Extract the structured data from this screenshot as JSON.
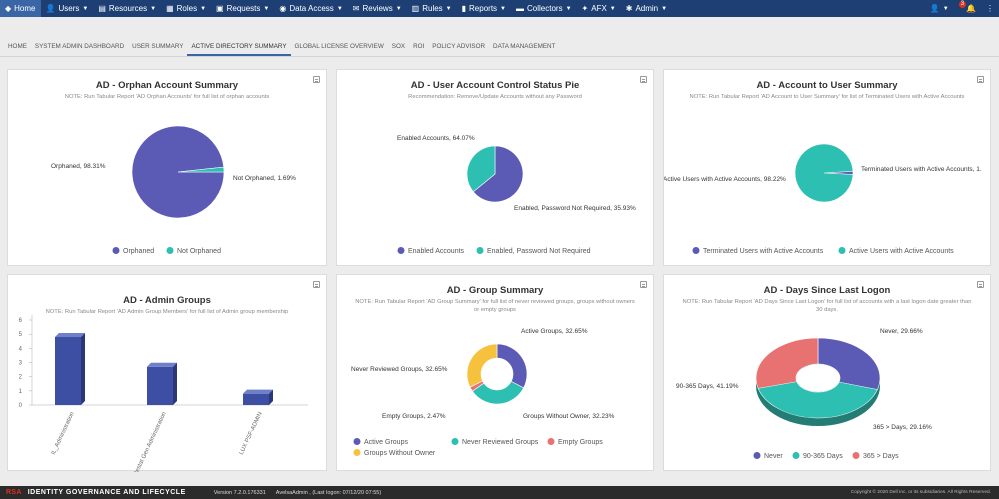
{
  "nav": {
    "items": [
      {
        "label": "Home",
        "icon": "logo-icon",
        "glyph": "◆",
        "caret": false,
        "active": true
      },
      {
        "label": "Users",
        "icon": "users-icon",
        "glyph": "👤",
        "caret": true
      },
      {
        "label": "Resources",
        "icon": "resources-icon",
        "glyph": "▤",
        "caret": true
      },
      {
        "label": "Roles",
        "icon": "roles-icon",
        "glyph": "▦",
        "caret": true
      },
      {
        "label": "Requests",
        "icon": "requests-icon",
        "glyph": "▣",
        "caret": true
      },
      {
        "label": "Data Access",
        "icon": "data-access-icon",
        "glyph": "◉",
        "caret": true
      },
      {
        "label": "Reviews",
        "icon": "reviews-icon",
        "glyph": "✉",
        "caret": true
      },
      {
        "label": "Rules",
        "icon": "rules-icon",
        "glyph": "▥",
        "caret": true
      },
      {
        "label": "Reports",
        "icon": "reports-icon",
        "glyph": "▮",
        "caret": true
      },
      {
        "label": "Collectors",
        "icon": "collectors-icon",
        "glyph": "▬",
        "caret": true
      },
      {
        "label": "AFX",
        "icon": "afx-icon",
        "glyph": "✦",
        "caret": true
      },
      {
        "label": "Admin",
        "icon": "admin-icon",
        "glyph": "✱",
        "caret": true
      }
    ],
    "notif_count": "3"
  },
  "tabs": [
    "Home",
    "System Admin Dashboard",
    "User Summary",
    "Active Directory Summary",
    "Global License Overview",
    "SOX",
    "ROI",
    "Policy Advisor",
    "Data Management"
  ],
  "panels": {
    "orphan": {
      "title": "AD - Orphan Account Summary",
      "note": "NOTE: Run Tabular Report 'AD Orphan Accounts' for full list of orphan accounts",
      "labels": [
        "Orphaned, 98.31%",
        "Not Orphaned, 1.69%"
      ],
      "legend": [
        "Orphaned",
        "Not Orphaned"
      ]
    },
    "uac": {
      "title": "AD - User Account Control Status Pie",
      "note": "Recommendation: Remove/Update Accounts without any Password",
      "labels": [
        "Enabled Accounts, 64.07%",
        "Enabled, Password Not Required, 35.93%"
      ],
      "legend": [
        "Enabled Accounts",
        "Enabled, Password Not Required"
      ]
    },
    "acct": {
      "title": "AD - Account to User Summary",
      "note": "NOTE: Run Tabular Report 'AD Account to User Summary' for list of Terminated Users with Active Accounts",
      "labels": [
        "Active Users with Active Accounts, 98.22%",
        "Terminated Users with Active Accounts, 1."
      ],
      "legend": [
        "Terminated Users with Active Accounts",
        "Active Users with Active Accounts"
      ]
    },
    "admin": {
      "title": "AD - Admin Groups",
      "note": "NOTE: Run Tabular Report 'AD Admin Group Members' for full list of Admin group membership"
    },
    "group": {
      "title": "AD - Group Summary",
      "note": "NOTE: Run Tabular Report 'AD Group Summary' for full list of never reviewed groups, groups without owners or empty groups",
      "labels": [
        "Active Groups, 32.65%",
        "Never Reviewed Groups, 32.65%",
        "Empty Groups, 2.47%",
        "Groups Without Owner, 32.23%"
      ],
      "legend": [
        "Active Groups",
        "Never Reviewed Groups",
        "Empty Groups",
        "Groups Without Owner"
      ]
    },
    "logon": {
      "title": "AD - Days Since Last Logon",
      "note": "NOTE: Run Tabular Report 'AD Days Since Last Logon' for full list of accounts with a last logon date greater than 30 days.",
      "labels": [
        "Never, 29.66%",
        "90-365 Days, 41.19%",
        "365 > Days, 29.16%"
      ],
      "legend": [
        "Never",
        "90-365 Days",
        "365 > Days"
      ]
    }
  },
  "chart_data": [
    {
      "type": "pie",
      "title": "AD - Orphan Account Summary",
      "categories": [
        "Orphaned",
        "Not Orphaned"
      ],
      "values": [
        98.31,
        1.69
      ],
      "colors": [
        "#5b5bb6",
        "#2cbfb2"
      ],
      "legend": "bottom"
    },
    {
      "type": "pie",
      "title": "AD - User Account Control Status Pie",
      "categories": [
        "Enabled Accounts",
        "Enabled, Password Not Required"
      ],
      "values": [
        64.07,
        35.93
      ],
      "colors": [
        "#5b5bb6",
        "#2cbfb2"
      ],
      "legend": "bottom"
    },
    {
      "type": "pie",
      "title": "AD - Account to User Summary",
      "categories": [
        "Terminated Users with Active Accounts",
        "Active Users with Active Accounts"
      ],
      "values": [
        1.78,
        98.22
      ],
      "colors": [
        "#5b5bb6",
        "#2cbfb2"
      ],
      "legend": "bottom"
    },
    {
      "type": "bar",
      "title": "AD - Admin Groups",
      "categories": [
        "IL_Administration",
        "IS Restat Gen Administration",
        "LUX PSF-ADMIN"
      ],
      "values": [
        4.8,
        2.7,
        0.8
      ],
      "ylim": [
        0,
        6
      ],
      "yticks": [
        "0",
        "1",
        "2",
        "3",
        "4",
        "5",
        "6"
      ],
      "colors": [
        "#3d4fa3"
      ]
    },
    {
      "type": "pie",
      "title": "AD - Group Summary",
      "categories": [
        "Active Groups",
        "Never Reviewed Groups",
        "Empty Groups",
        "Groups Without Owner"
      ],
      "values": [
        32.65,
        32.65,
        2.47,
        32.23
      ],
      "colors": [
        "#5b5bb6",
        "#2cbfb2",
        "#e87272",
        "#f6c23e"
      ],
      "legend": "bottom"
    },
    {
      "type": "pie",
      "title": "AD - Days Since Last Logon",
      "categories": [
        "Never",
        "90-365 Days",
        "365 > Days"
      ],
      "values": [
        29.66,
        41.19,
        29.16
      ],
      "colors": [
        "#5b5bb6",
        "#2cbfb2",
        "#e87272"
      ],
      "legend": "bottom"
    }
  ],
  "footer": {
    "logo": "RSA",
    "product": "IDENTITY GOVERNANCE AND LIFECYCLE",
    "version": "Version 7.2.0.176331",
    "user": "AvelsaAdmin , (Last logon: 07/12/20 07:55)",
    "copyright": "Copyright © 2020 Dell Inc. or its subsidiaries. All Rights Reserved."
  }
}
